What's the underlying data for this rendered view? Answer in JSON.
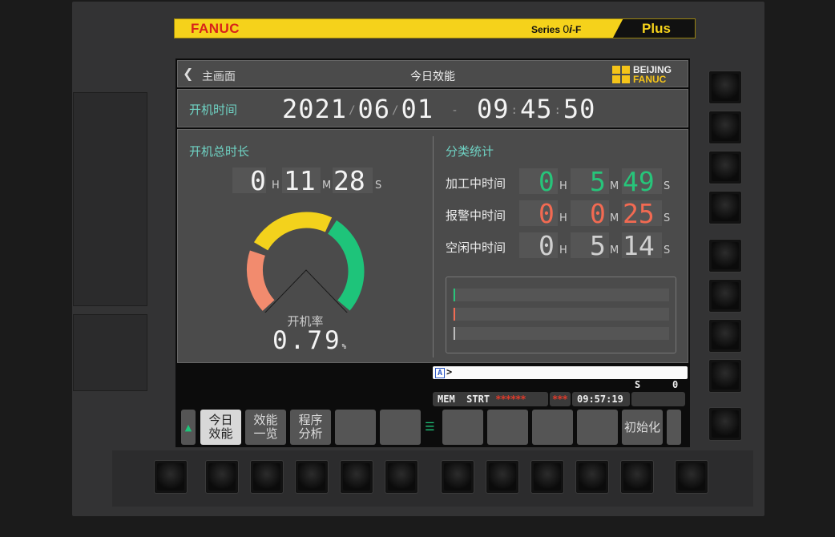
{
  "banner": {
    "brand": "FANUC",
    "series_prefix": "Series ",
    "series_model": "0",
    "series_i": "i",
    "series_suffix": "-F",
    "plus": "Plus"
  },
  "topbar": {
    "back_label": "主画面",
    "title": "今日效能",
    "logo_line1": "BEIJING",
    "logo_line2": "FANUC"
  },
  "datetime": {
    "label": "开机时间",
    "year": "2021",
    "month": "06",
    "day": "01",
    "hour": "09",
    "minute": "45",
    "second": "50",
    "date_sep": "/",
    "dash": "-",
    "time_sep": ":"
  },
  "total": {
    "label": "开机总时长",
    "hours": "0",
    "minutes": "11",
    "seconds": "28",
    "unit_h": "H",
    "unit_m": "M",
    "unit_s": "S"
  },
  "gauge": {
    "label": "开机率",
    "value_text": "0.79",
    "unit": "%",
    "value": 0.79,
    "colors": {
      "alarm": "#f28b6e",
      "idle": "#f3d21c",
      "run": "#1ec47a"
    }
  },
  "stats": {
    "label": "分类统计",
    "rows": [
      {
        "label": "加工中时间",
        "hours": "0",
        "minutes": "5",
        "seconds": "49",
        "color": "#27c47a"
      },
      {
        "label": "报警中时间",
        "hours": "0",
        "minutes": "0",
        "seconds": "25",
        "color": "#f26a52"
      },
      {
        "label": "空闲中时间",
        "hours": "0",
        "minutes": "5",
        "seconds": "14",
        "color": "#d0d0d0"
      }
    ],
    "units": {
      "h": "H",
      "m": "M",
      "s": "S"
    }
  },
  "command": {
    "tag": "A",
    "prompt": ">"
  },
  "status": {
    "s_label": "S",
    "s_value": "0",
    "mode": "MEM",
    "state": "STRT",
    "stars": "******",
    "stars2": "***",
    "time": "09:57:19"
  },
  "softkeys": {
    "k1": "今日\n效能",
    "k2": "效能\n一览",
    "k3": "程序\n分析",
    "k4": "初始化"
  }
}
